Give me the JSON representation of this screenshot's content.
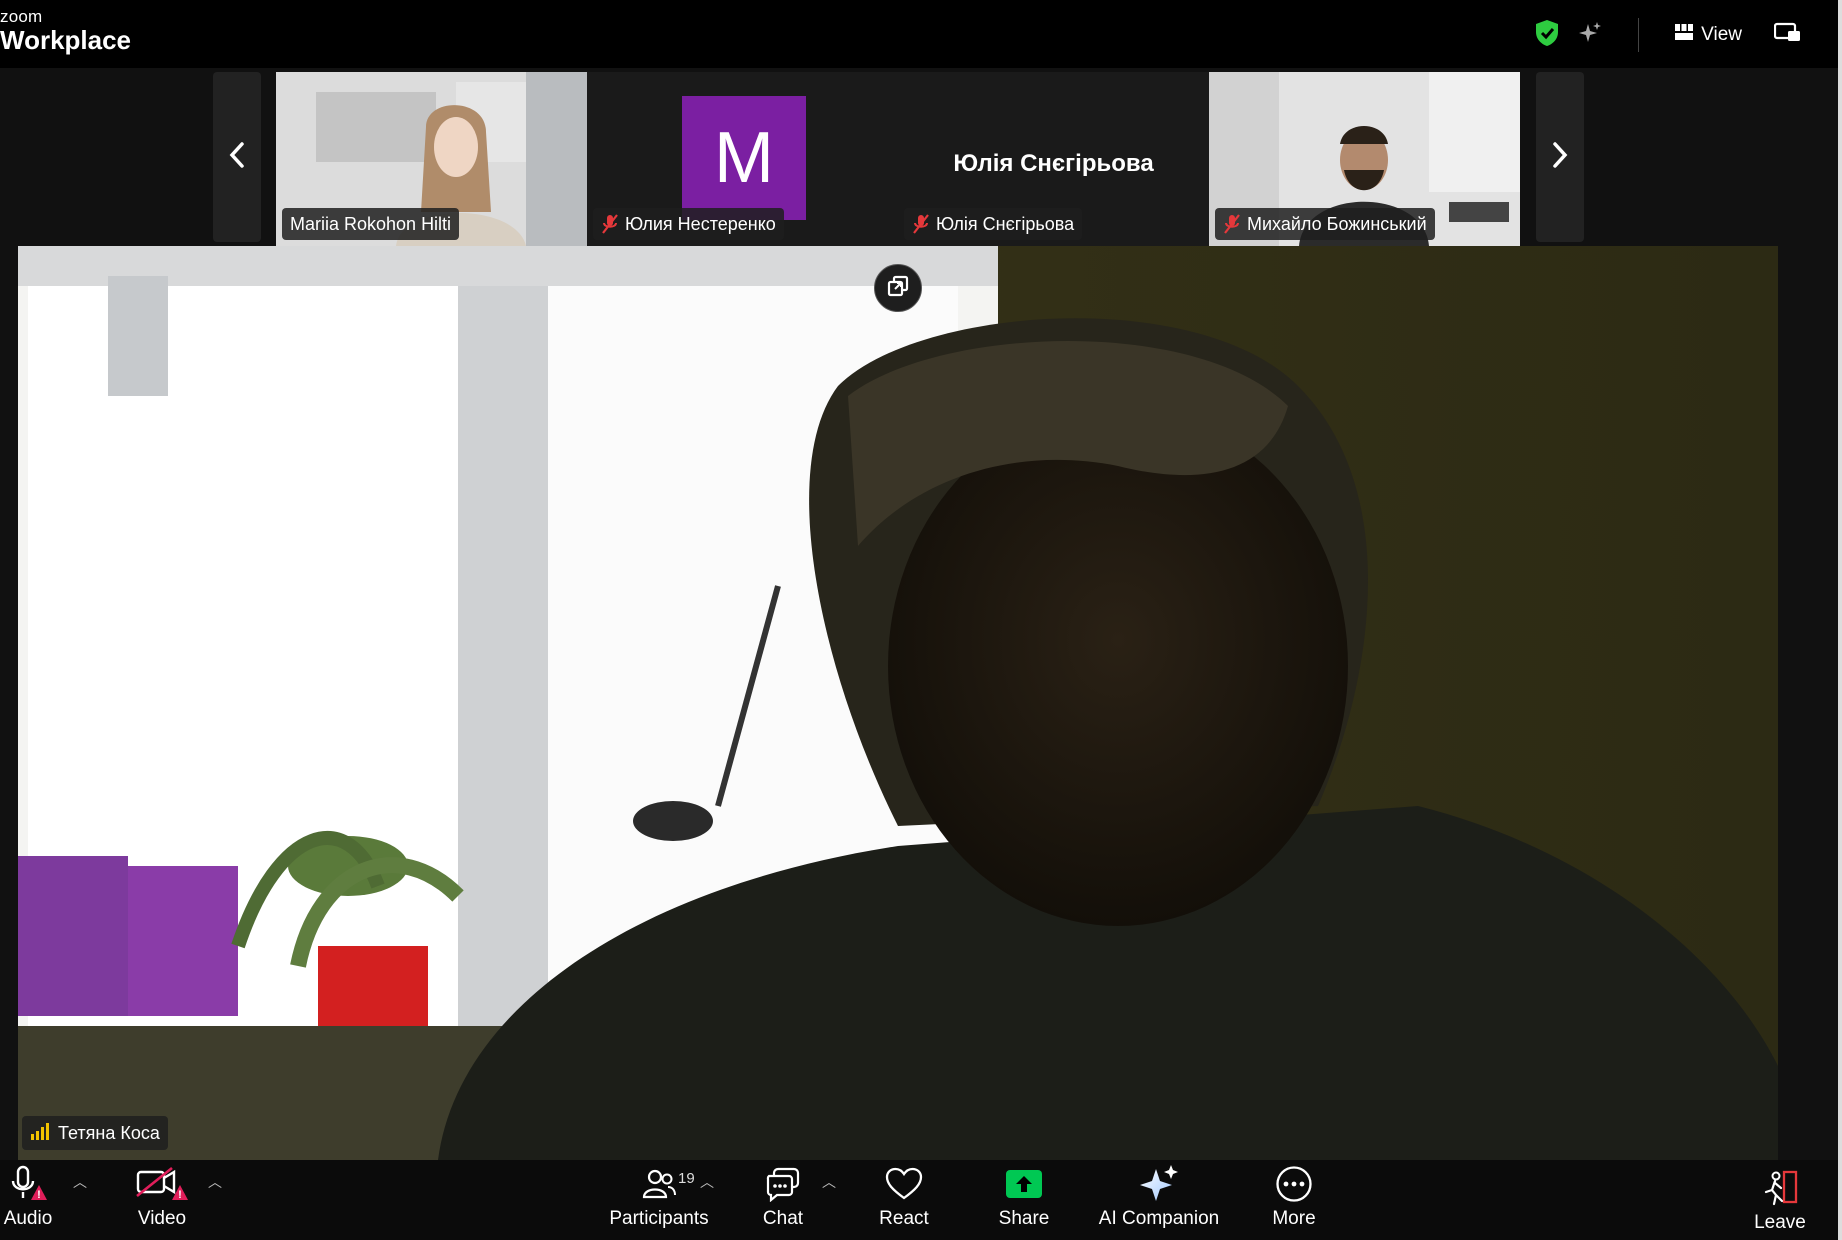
{
  "app": {
    "brand_small": "zoom",
    "brand_big": "Workplace",
    "view_label": "View"
  },
  "thumbnails": [
    {
      "name": "Mariia Rokohon Hilti",
      "muted": false,
      "type": "video"
    },
    {
      "name": "Юлия Нестеренко",
      "muted": true,
      "type": "avatar",
      "avatar_letter": "M",
      "avatar_color": "#7b1fa2"
    },
    {
      "name": "Юлія Снєгірьова",
      "muted": true,
      "type": "name_only",
      "display_name": "Юлія Снєгірьова"
    },
    {
      "name": "Михайло Божинський",
      "muted": true,
      "type": "video"
    }
  ],
  "main_video": {
    "speaker_name": "Тетяна Коса"
  },
  "toolbar": {
    "audio": "Audio",
    "video": "Video",
    "participants": "Participants",
    "participants_count": "19",
    "chat": "Chat",
    "react": "React",
    "share": "Share",
    "ai_companion": "AI Companion",
    "more": "More",
    "leave": "Leave"
  },
  "colors": {
    "accent_green": "#00c853",
    "muted_red": "#e5383b",
    "warning_red": "#e01e5a",
    "security_green": "#2ecc40"
  }
}
